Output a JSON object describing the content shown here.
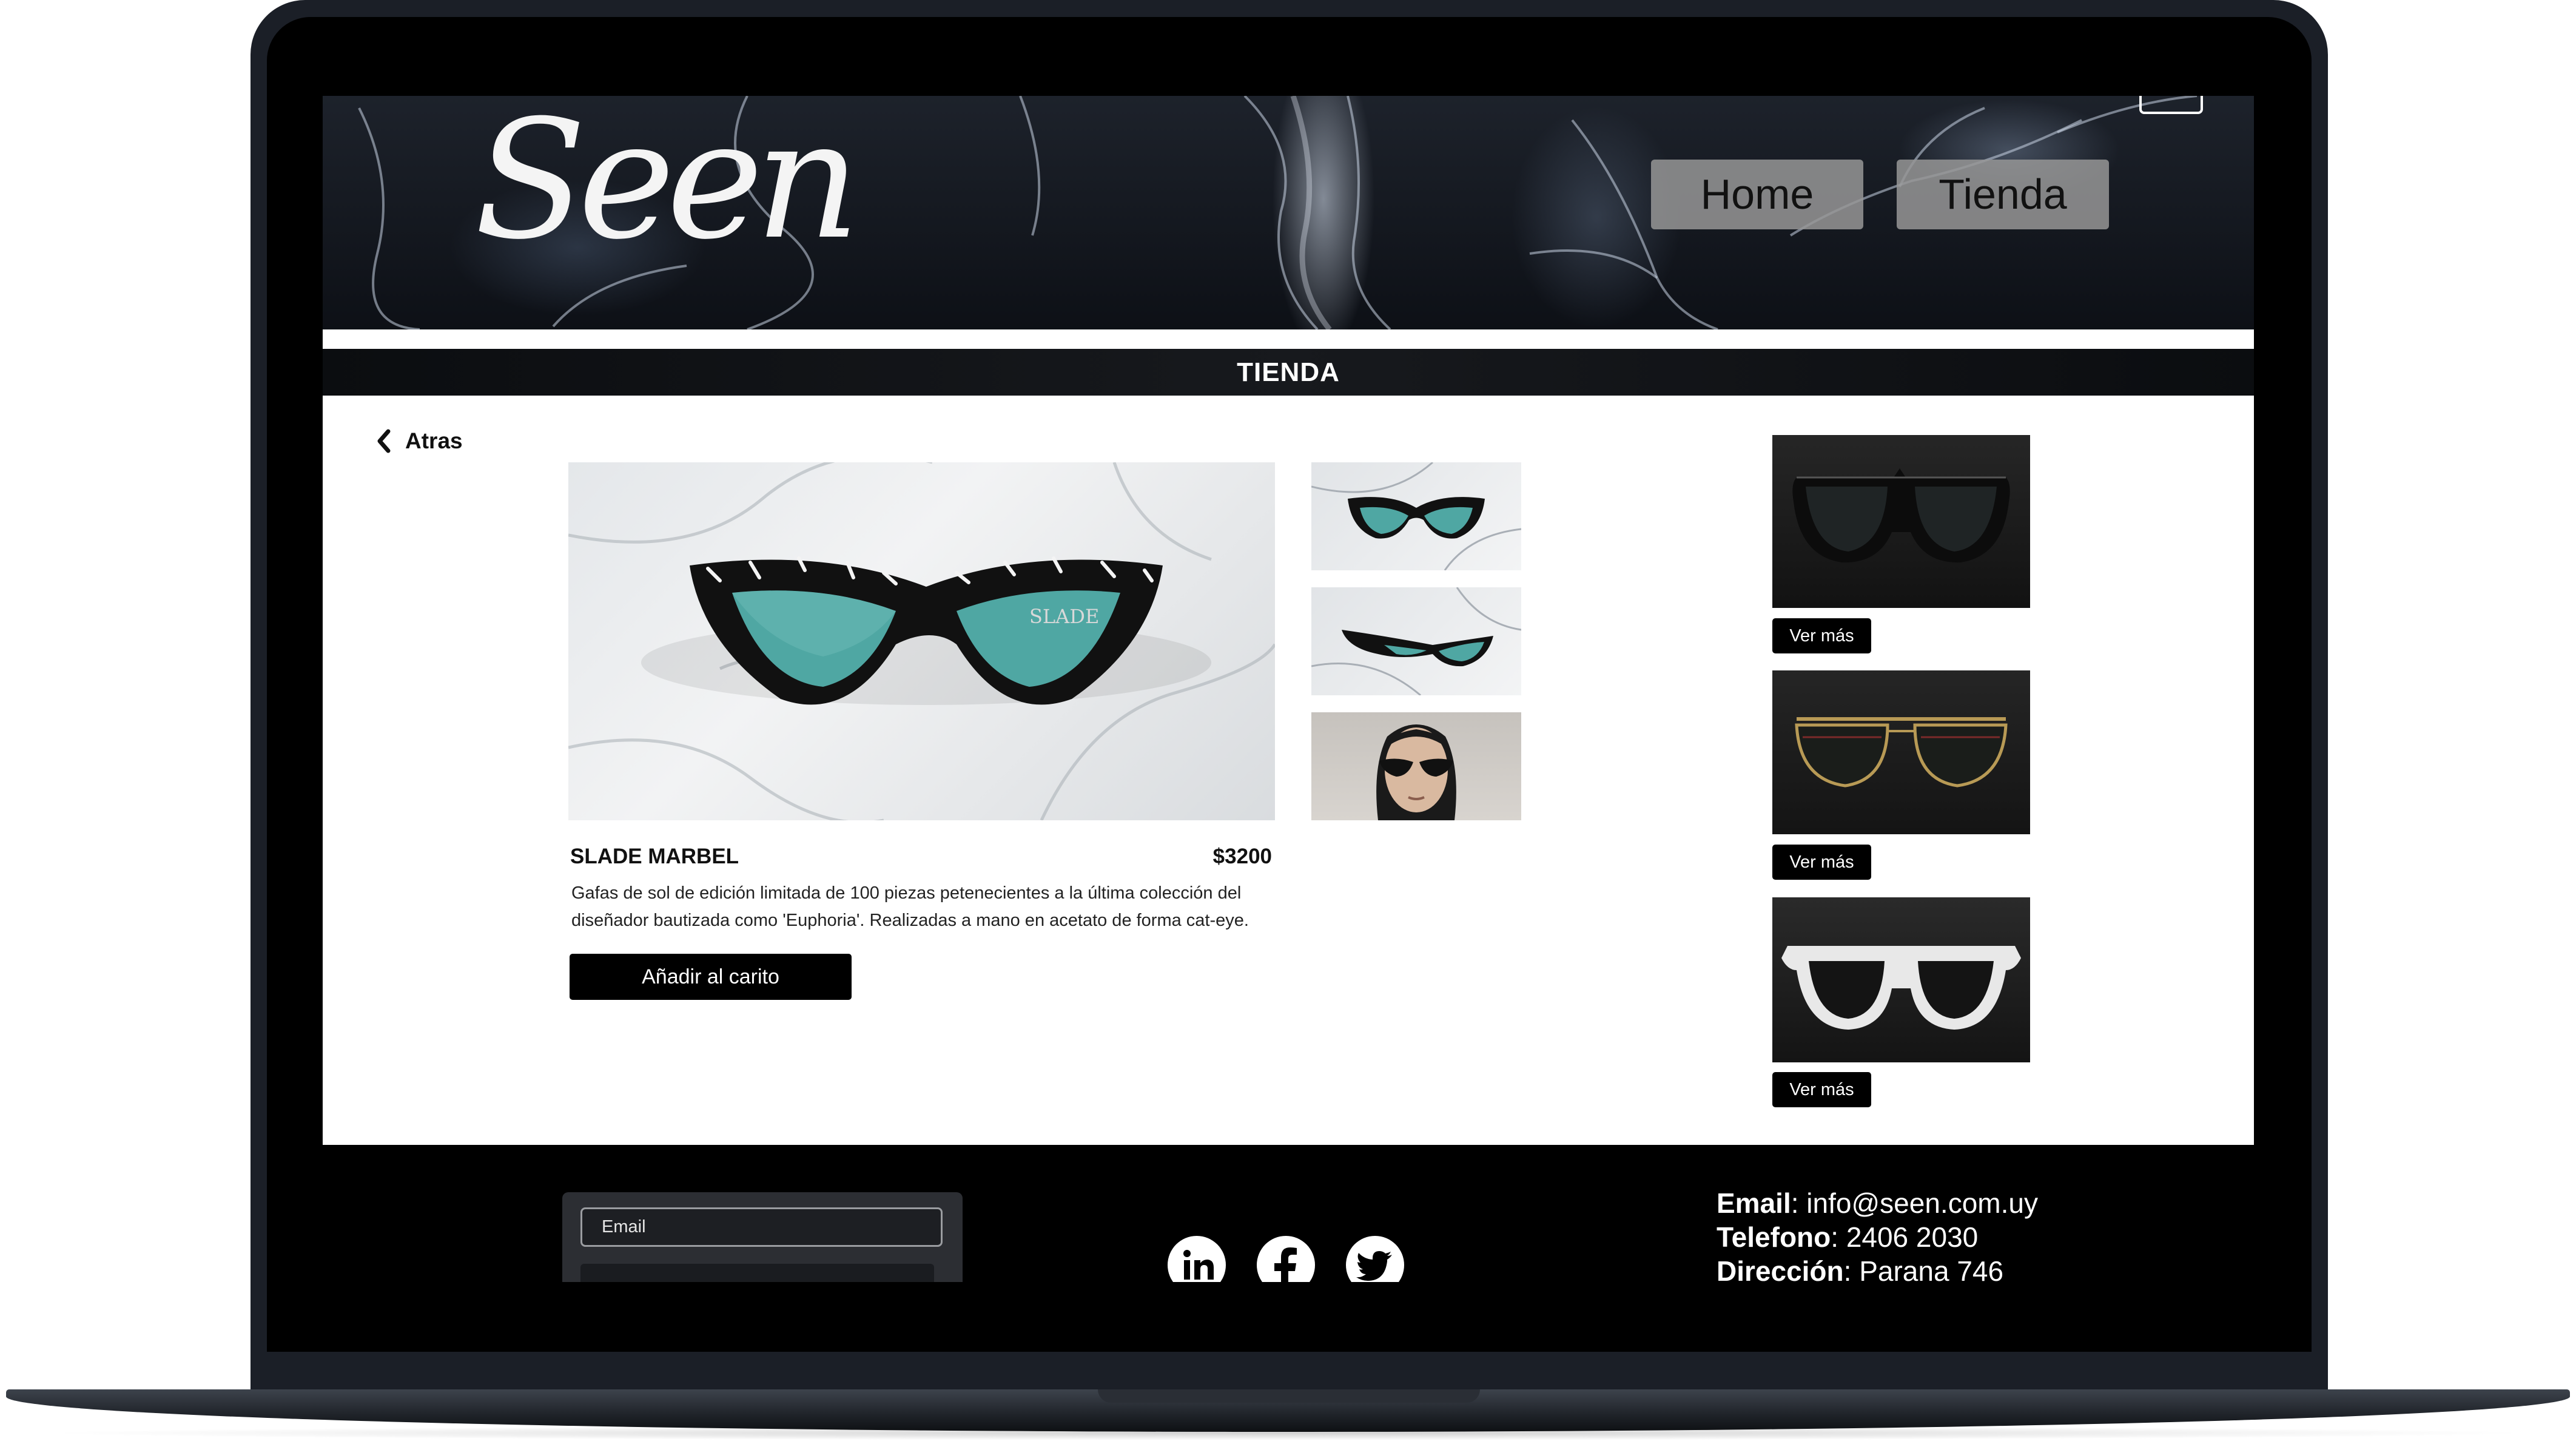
{
  "header": {
    "logo_text": "Seen",
    "nav": [
      {
        "label": "Home"
      },
      {
        "label": "Tienda"
      }
    ]
  },
  "section": {
    "title": "TIENDA"
  },
  "back": {
    "label": "Atras"
  },
  "product": {
    "name": "SLADE MARBEL",
    "price": "$3200",
    "description": "Gafas de sol de edición limitada de 100 piezas petenecientes a la última colección del diseñador bautizada como 'Euphoria'. Realizadas a mano en acetato de forma cat-eye.",
    "add_to_cart_label": "Añadir al carito",
    "frame_engraving": "SLADE"
  },
  "related": [
    {
      "button_label": "Ver más"
    },
    {
      "button_label": "Ver más"
    },
    {
      "button_label": "Ver más"
    }
  ],
  "footer": {
    "email_placeholder": "Email",
    "contact": {
      "email_label": "Email",
      "email_value": "info@seen.com.uy",
      "phone_label": "Telefono",
      "phone_value": "2406 2030",
      "address_label": "Dirección",
      "address_value": "Parana 746"
    },
    "social_icons": [
      "linkedin-icon",
      "facebook-icon",
      "twitter-icon"
    ]
  },
  "colors": {
    "primary_button": "#000000",
    "nav_button": "#969696",
    "lens_teal": "#4fa7a3"
  }
}
